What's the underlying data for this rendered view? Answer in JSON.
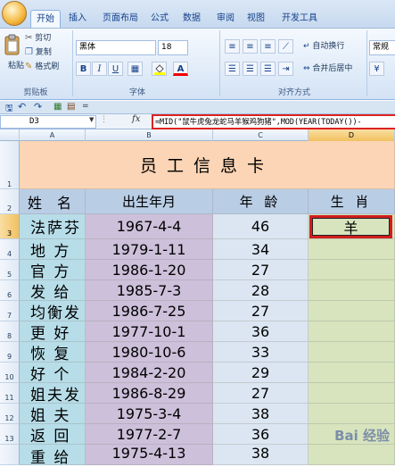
{
  "tabs": [
    "开始",
    "插入",
    "页面布局",
    "公式",
    "数据",
    "审阅",
    "视图",
    "开发工具"
  ],
  "clipboard": {
    "paste": "粘贴",
    "cut": "剪切",
    "copy": "复制",
    "format_painter": "格式刷",
    "label": "剪贴板"
  },
  "font": {
    "name": "黑体",
    "size": "18",
    "label": "字体"
  },
  "alignment": {
    "wrap": "自动换行",
    "merge": "合并后居中",
    "label": "对齐方式"
  },
  "number": {
    "format": "常规"
  },
  "icons": [
    "paste-icon",
    "cut-icon",
    "copy-icon",
    "format-painter-icon",
    "bold-icon",
    "italic-icon",
    "underline-icon",
    "fill-color-icon",
    "font-color-icon",
    "save-icon",
    "undo-icon",
    "redo-icon",
    "fx-icon"
  ],
  "formula_bar": {
    "name_box": "D3",
    "fx": "fx",
    "formula": "=MID(\"鼠牛虎兔龙蛇马羊猴鸡狗猪\",MOD(YEAR(TODAY())-"
  },
  "columns": [
    "A",
    "B",
    "C",
    "D"
  ],
  "rows": [
    "1",
    "2",
    "3",
    "4",
    "5",
    "6",
    "7",
    "8",
    "9",
    "10",
    "11",
    "12",
    "13",
    ""
  ],
  "sheet": {
    "title": "员工信息卡",
    "headers": {
      "name": "姓 名",
      "birth": "出生年月",
      "age": "年 龄",
      "zodiac": "生 肖"
    },
    "records": [
      {
        "name": "法萨芬",
        "birth": "1967-4-4",
        "age": "46",
        "zodiac": "羊"
      },
      {
        "name": "地  方",
        "birth": "1979-1-11",
        "age": "34",
        "zodiac": ""
      },
      {
        "name": "官  方",
        "birth": "1986-1-20",
        "age": "27",
        "zodiac": ""
      },
      {
        "name": "发  给",
        "birth": "1985-7-3",
        "age": "28",
        "zodiac": ""
      },
      {
        "name": "均衡发",
        "birth": "1986-7-25",
        "age": "27",
        "zodiac": ""
      },
      {
        "name": "更  好",
        "birth": "1977-10-1",
        "age": "36",
        "zodiac": ""
      },
      {
        "name": "恢  复",
        "birth": "1980-10-6",
        "age": "33",
        "zodiac": ""
      },
      {
        "name": "好  个",
        "birth": "1984-2-20",
        "age": "29",
        "zodiac": ""
      },
      {
        "name": "姐夫发",
        "birth": "1986-8-29",
        "age": "27",
        "zodiac": ""
      },
      {
        "name": "姐  夫",
        "birth": "1975-3-4",
        "age": "38",
        "zodiac": ""
      },
      {
        "name": "返  回",
        "birth": "1977-2-7",
        "age": "36",
        "zodiac": ""
      },
      {
        "name": "重  给",
        "birth": "1975-4-13",
        "age": "38",
        "zodiac": ""
      }
    ]
  },
  "watermark": "Bai 经验",
  "colors": {
    "title_bg": "#fbd5b5",
    "header_bg": "#b9cde5",
    "name_col": "#b7dde8",
    "birth_col": "#ccc0da",
    "age_col": "#dce6f2",
    "zodiac_col": "#d7e4bd",
    "highlight": "#d11d1d"
  }
}
